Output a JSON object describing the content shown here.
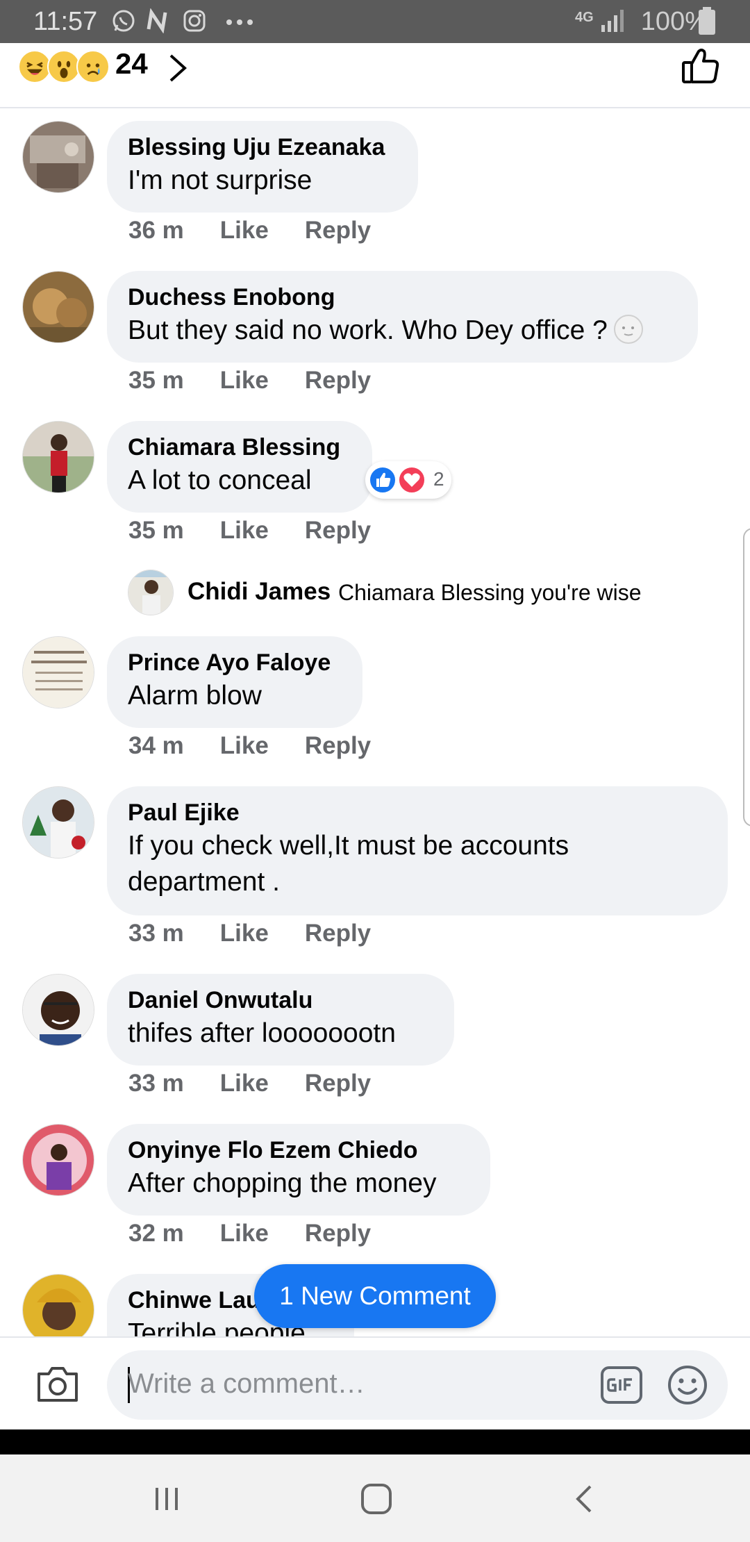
{
  "status_bar": {
    "time": "11:57",
    "network": "4G",
    "battery": "100%",
    "icons": [
      "whatsapp-icon",
      "n-app-icon",
      "instagram-icon",
      "more-dots-icon",
      "signal-icon",
      "battery-icon"
    ]
  },
  "reactions_header": {
    "emojis": [
      "haha-emoji",
      "wow-emoji",
      "sad-emoji"
    ],
    "count": "24"
  },
  "comments": [
    {
      "author": "Blessing Uju Ezeanaka",
      "text": "I'm not surprise",
      "time": "36 m",
      "like": "Like",
      "reply": "Reply"
    },
    {
      "author": "Duchess Enobong",
      "text": "But they said no work. Who Dey office ?",
      "time": "35 m",
      "like": "Like",
      "reply": "Reply"
    },
    {
      "author": "Chiamara Blessing",
      "text": "A lot to conceal",
      "time": "35 m",
      "like": "Like",
      "reply": "Reply",
      "reaction_count": "2"
    },
    {
      "author": "Prince Ayo Faloye",
      "text": "Alarm blow",
      "time": "34 m",
      "like": "Like",
      "reply": "Reply"
    },
    {
      "author": "Paul Ejike",
      "text": "If you check well,It must be accounts department .",
      "time": "33 m",
      "like": "Like",
      "reply": "Reply"
    },
    {
      "author": "Daniel Onwutalu",
      "text": "thifes after loooooootn",
      "time": "33 m",
      "like": "Like",
      "reply": "Reply"
    },
    {
      "author": "Onyinye Flo Ezem Chiedo",
      "text": "After chopping the money",
      "time": "32 m",
      "like": "Like",
      "reply": "Reply"
    },
    {
      "author": "Chinwe Lau",
      "text": "Terrible people"
    }
  ],
  "reply_preview": {
    "author": "Chidi James",
    "text": "Chiamara Blessing you're wise"
  },
  "new_comment_button": "1 New Comment",
  "composer": {
    "placeholder": "Write a comment…"
  },
  "colors": {
    "accent": "#1877f2",
    "bubble": "#f0f2f5",
    "meta_text": "#65676b",
    "love": "#f33e58"
  }
}
